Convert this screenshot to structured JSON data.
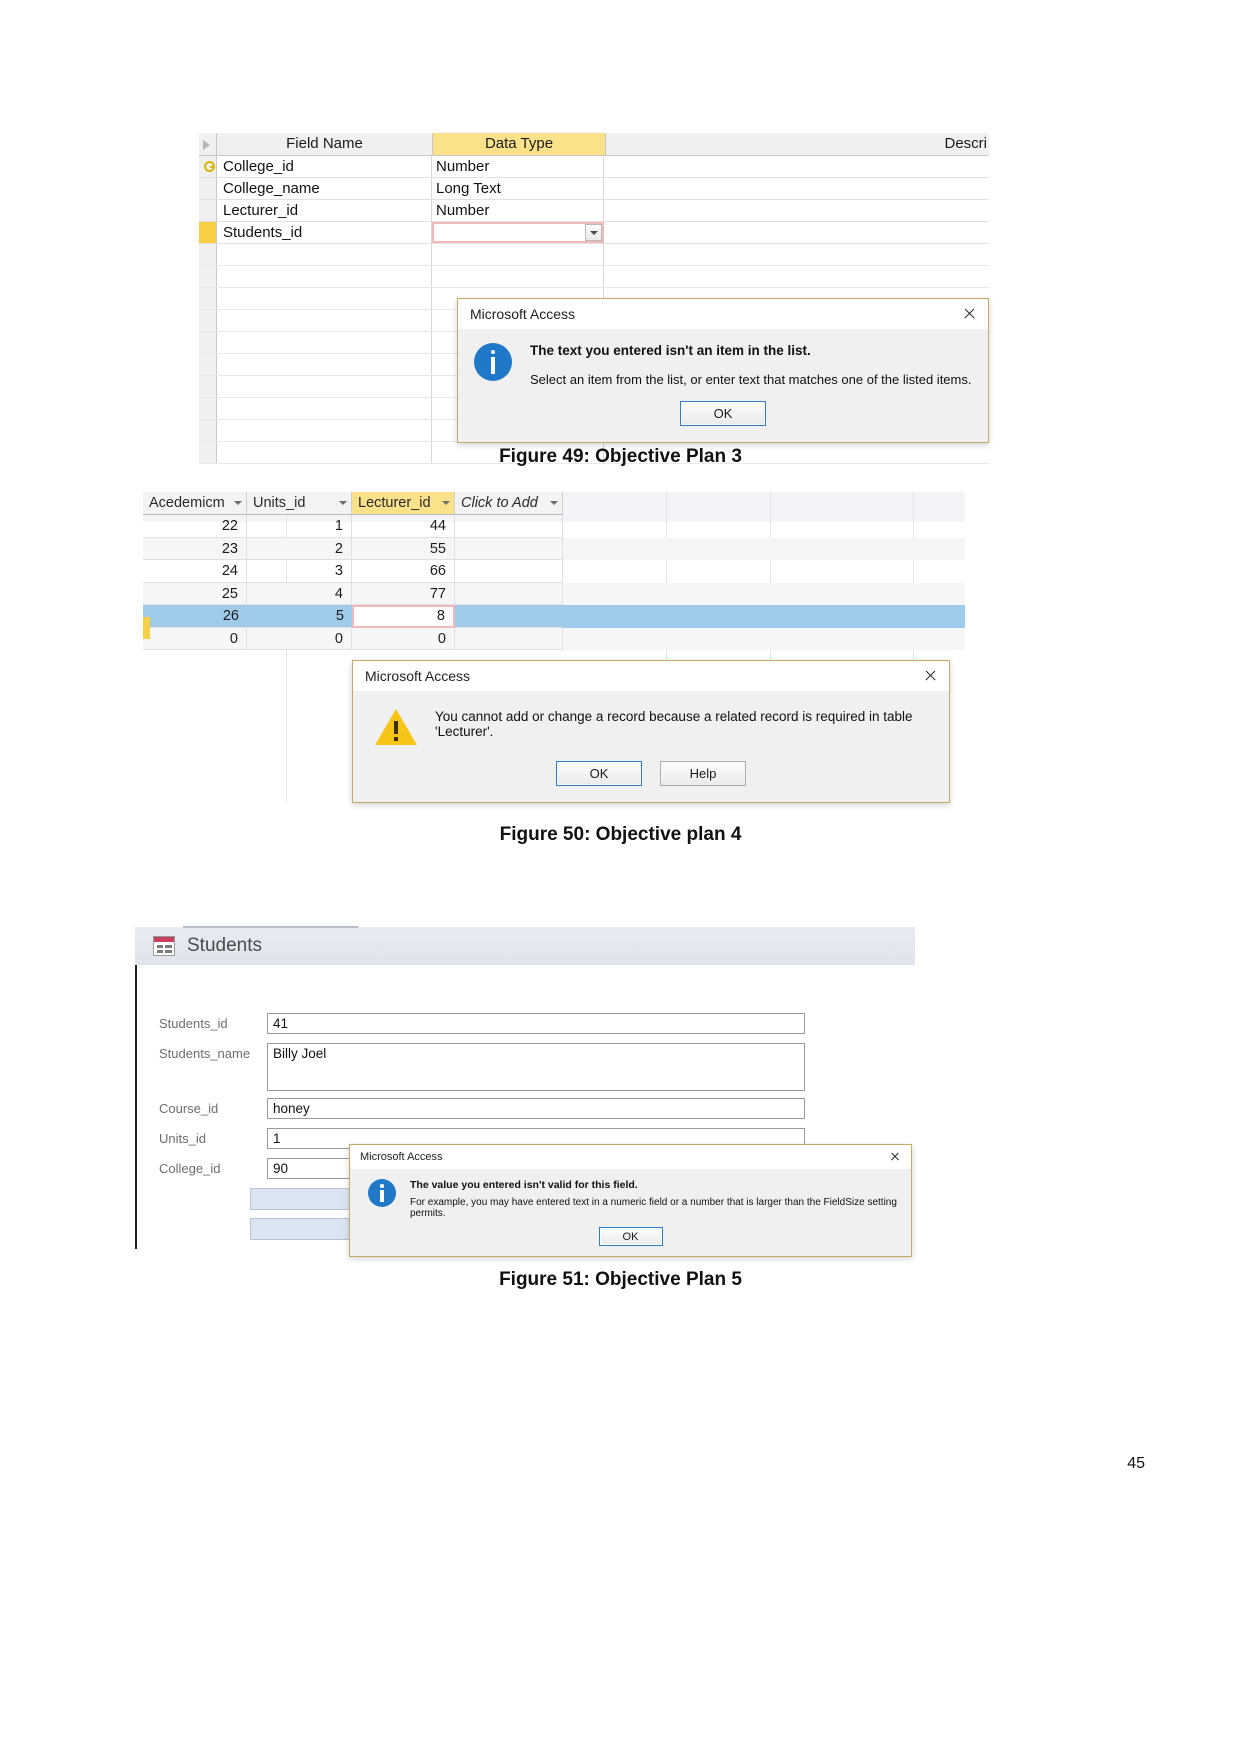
{
  "figure49": {
    "design_view": {
      "headers": {
        "field_name": "Field Name",
        "data_type": "Data Type",
        "description": "Descri"
      },
      "rows": [
        {
          "name": "College_id",
          "type": "Number",
          "primary_key": true
        },
        {
          "name": "College_name",
          "type": "Long Text",
          "primary_key": false
        },
        {
          "name": "Lecturer_id",
          "type": "Number",
          "primary_key": false
        },
        {
          "name": "Students_id",
          "type": "",
          "primary_key": false,
          "editing": true
        }
      ]
    },
    "dialog": {
      "title": "Microsoft Access",
      "icon": "info-icon",
      "line1": "The text you entered isn't an item in the list.",
      "line2": "Select an item from the list, or enter text that matches one of the listed items.",
      "ok_label": "OK"
    },
    "caption": "Figure 49: Objective Plan 3"
  },
  "figure50": {
    "datasheet": {
      "columns": [
        "Acedemicm",
        "Units_id",
        "Lecturer_id",
        "Click to Add"
      ],
      "selected_column": "Lecturer_id",
      "rows": [
        {
          "values": [
            "22",
            "1",
            "44"
          ],
          "selected": false
        },
        {
          "values": [
            "23",
            "2",
            "55"
          ],
          "selected": false
        },
        {
          "values": [
            "24",
            "3",
            "66"
          ],
          "selected": false
        },
        {
          "values": [
            "25",
            "4",
            "77"
          ],
          "selected": false
        },
        {
          "values": [
            "26",
            "5",
            "8"
          ],
          "selected": true,
          "editing_col": 2
        },
        {
          "values": [
            "0",
            "0",
            "0"
          ],
          "selected": false
        }
      ]
    },
    "dialog": {
      "title": "Microsoft Access",
      "icon": "warning-icon",
      "message": "You cannot add or change a record because a related record is required in table 'Lecturer'.",
      "ok_label": "OK",
      "help_label": "Help"
    },
    "caption": "Figure 50: Objective plan 4"
  },
  "figure51": {
    "form": {
      "title": "Students",
      "fields": [
        {
          "label": "Students_id",
          "value": "41"
        },
        {
          "label": "Students_name",
          "value": "Billy Joel"
        },
        {
          "label": "Course_id",
          "value": "honey"
        },
        {
          "label": "Units_id",
          "value": "1"
        },
        {
          "label": "College_id",
          "value": "90"
        }
      ]
    },
    "dialog": {
      "title": "Microsoft Access",
      "icon": "info-icon",
      "line1": "The value you entered isn't valid for this field.",
      "line2": "For example, you may have entered text in a numeric field or a number that is larger than the FieldSize setting permits.",
      "ok_label": "OK"
    },
    "caption": "Figure 51: Objective Plan 5"
  },
  "page": {
    "number": "45"
  },
  "colors": {
    "header_yellow": "#fbe18a",
    "selection_blue": "#9ecbea",
    "error_border": "#f3b9b9",
    "info_blue": "#1f78c8",
    "warning_yellow": "#f5c518"
  }
}
